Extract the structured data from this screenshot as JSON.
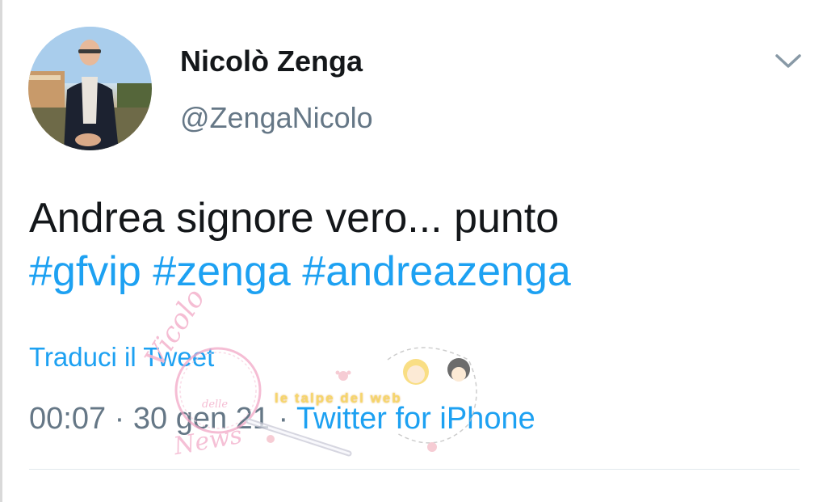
{
  "tweet": {
    "author": {
      "display_name": "Nicolò Zenga",
      "handle": "@ZengaNicolo"
    },
    "text_line1": "Andrea signore vero... punto",
    "hashtags": [
      "#gfvip",
      "#zenga",
      "#andreazenga"
    ],
    "translate_label": "Traduci il Tweet",
    "time": "00:07",
    "date": "30 gen 21",
    "separator": "·",
    "source": "Twitter for iPhone",
    "menu_icon": "chevron-down-icon"
  },
  "watermark": {
    "script_text": "Vicolo",
    "small_text": "delle",
    "script_text2": "News",
    "band_text": "le talpe del web"
  },
  "colors": {
    "text_primary": "#14171a",
    "text_secondary": "#657786",
    "link": "#1da1f2",
    "divider": "#e1e8ed",
    "watermark_pink": "#f4b6cf",
    "watermark_yellow": "#f6d25a"
  }
}
